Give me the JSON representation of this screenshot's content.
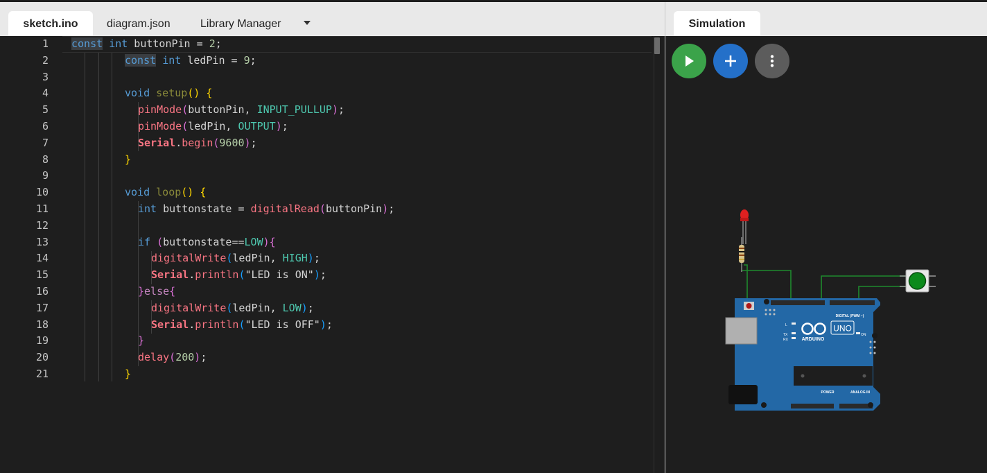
{
  "tabs": {
    "sketch": "sketch.ino",
    "diagram": "diagram.json",
    "library": "Library Manager"
  },
  "simulation": {
    "tab_label": "Simulation",
    "board_name": "UNO",
    "board_brand": "ARDUINO",
    "digital_label": "DIGITAL (PWM ~)",
    "analog_label": "ANALOG IN",
    "power_label": "POWER",
    "on_label": "ON",
    "tx_label": "TX",
    "rx_label": "RX",
    "l_label": "L",
    "led_color": "#e02020",
    "button_color": "#0b8a1b",
    "wire_color": "#1e8a2e",
    "board_color": "#2368a6"
  },
  "colors": {
    "play": "#3ba34a",
    "add": "#2470c9",
    "more": "#5c5c5c"
  },
  "code": {
    "line_numbers": [
      "1",
      "2",
      "3",
      "4",
      "5",
      "6",
      "7",
      "8",
      "9",
      "10",
      "11",
      "12",
      "13",
      "14",
      "15",
      "16",
      "17",
      "18",
      "19",
      "20",
      "21"
    ]
  }
}
